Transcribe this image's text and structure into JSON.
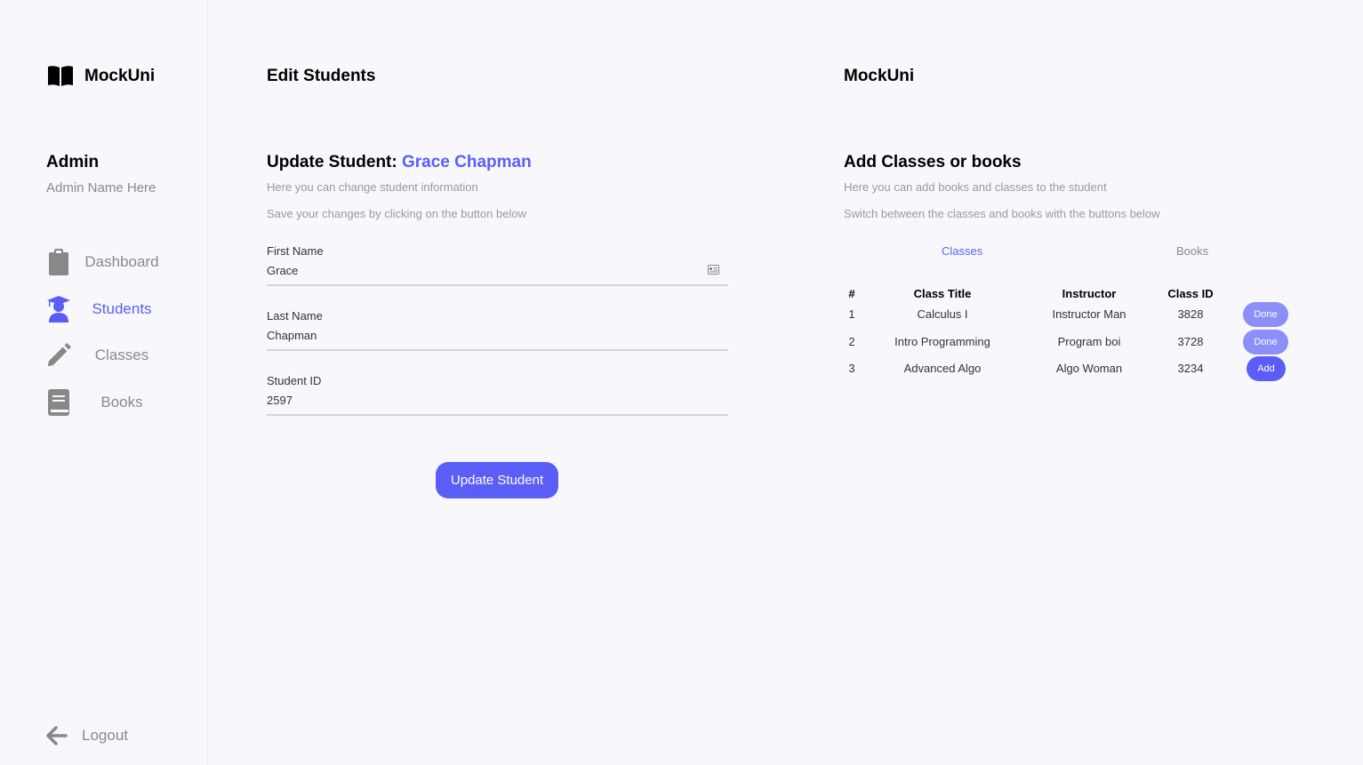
{
  "sidebar": {
    "brand": "MockUni",
    "admin_title": "Admin",
    "admin_name": "Admin Name Here",
    "items": [
      {
        "label": "Dashboard",
        "icon": "clipboard-icon"
      },
      {
        "label": "Students",
        "icon": "graduate-icon"
      },
      {
        "label": "Classes",
        "icon": "pencil-icon"
      },
      {
        "label": "Books",
        "icon": "book-icon"
      }
    ],
    "logout": "Logout"
  },
  "main": {
    "page_title": "Edit Students",
    "section_title": "Update Student: ",
    "student_name": "Grace Chapman",
    "hint1": "Here you can change student information",
    "hint2": "Save your changes by clicking on the button below",
    "fields": [
      {
        "label": "First Name",
        "value": "Grace"
      },
      {
        "label": "Last Name",
        "value": "Chapman"
      },
      {
        "label": "Student ID",
        "value": "2597"
      }
    ],
    "update_button": "Update Student"
  },
  "right": {
    "brand": "MockUni",
    "section_title": "Add Classes or books",
    "hint1": "Here you can add books and classes to the student",
    "hint2": "Switch between the classes and books with the buttons below",
    "tabs": [
      "Classes",
      "Books"
    ],
    "headers": [
      "#",
      "Class Title",
      "Instructor",
      "Class ID"
    ],
    "rows": [
      {
        "num": "1",
        "title": "Calculus I",
        "instructor": "Instructor Man",
        "id": "3828",
        "action": "Done"
      },
      {
        "num": "2",
        "title": "Intro Programming",
        "instructor": "Program boi",
        "id": "3728",
        "action": "Done"
      },
      {
        "num": "3",
        "title": "Advanced Algo",
        "instructor": "Algo Woman",
        "id": "3234",
        "action": "Add"
      }
    ]
  },
  "colors": {
    "accent": "#5b5ef6",
    "accent_light": "#8c8ff7",
    "muted": "#8a8a8a"
  }
}
